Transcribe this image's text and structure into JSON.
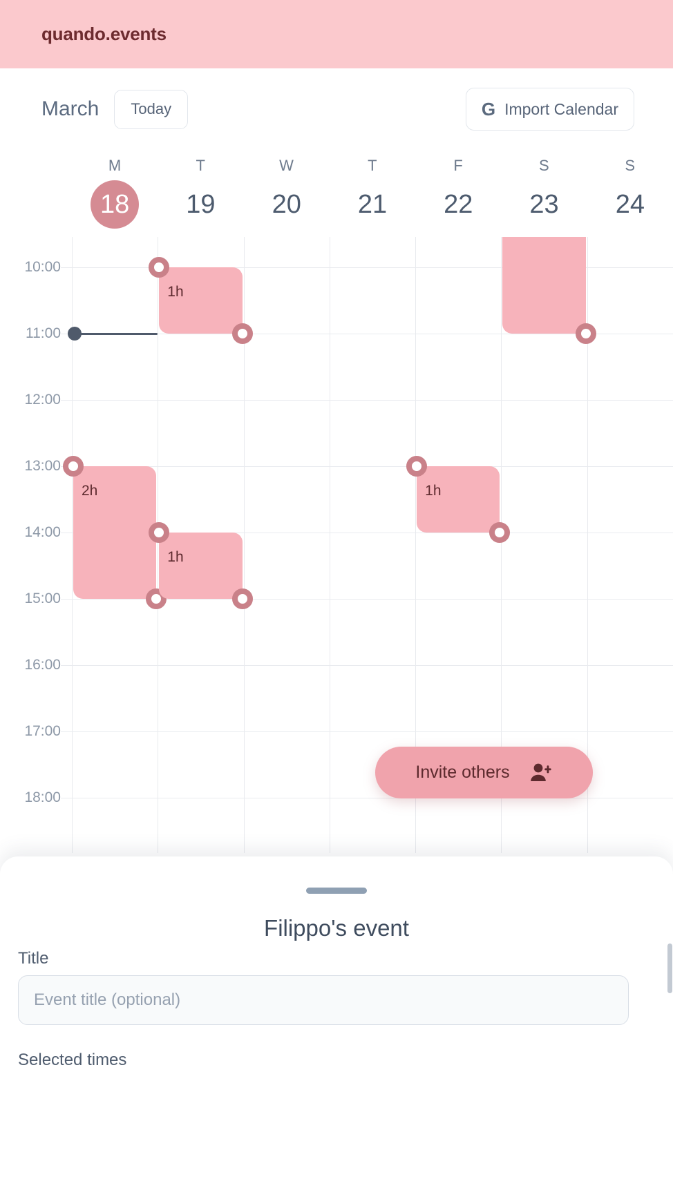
{
  "brand": {
    "name": "quando.events"
  },
  "toolbar": {
    "month": "March",
    "today_label": "Today",
    "import_label": "Import Calendar",
    "google_glyph": "G"
  },
  "week": {
    "days": [
      {
        "dow": "M",
        "num": "18",
        "selected": true
      },
      {
        "dow": "T",
        "num": "19",
        "selected": false
      },
      {
        "dow": "W",
        "num": "20",
        "selected": false
      },
      {
        "dow": "T",
        "num": "21",
        "selected": false
      },
      {
        "dow": "F",
        "num": "22",
        "selected": false
      },
      {
        "dow": "S",
        "num": "23",
        "selected": false
      },
      {
        "dow": "S",
        "num": "24",
        "selected": false
      }
    ]
  },
  "calendar": {
    "hours": [
      "10:00",
      "11:00",
      "12:00",
      "13:00",
      "14:00",
      "15:00",
      "16:00",
      "17:00",
      "18:00"
    ],
    "now_time": "11:00",
    "now_day_index": 0,
    "events": [
      {
        "day_index": 1,
        "start": "10:00",
        "end": "11:00",
        "duration_label": "1h"
      },
      {
        "day_index": 5,
        "start": "09:00",
        "end": "11:00",
        "duration_label": "",
        "clipped_top": true
      },
      {
        "day_index": 0,
        "start": "13:00",
        "end": "15:00",
        "duration_label": "2h"
      },
      {
        "day_index": 1,
        "start": "14:00",
        "end": "15:00",
        "duration_label": "1h"
      },
      {
        "day_index": 4,
        "start": "13:00",
        "end": "14:00",
        "duration_label": "1h"
      }
    ]
  },
  "invite": {
    "label": "Invite others",
    "icon": "person-add-icon"
  },
  "sheet": {
    "title": "Filippo's event",
    "title_field_label": "Title",
    "title_placeholder": "Event title (optional)",
    "title_value": "",
    "selected_times_label": "Selected times"
  },
  "colors": {
    "brand_bar": "#fbc9cd",
    "brand_text": "#6d2b2f",
    "event_fill": "#f7b3bb",
    "handle_ring": "#c98189",
    "selected_day": "#d58b93",
    "accent_fab": "#f0a3ac",
    "text_muted": "#8d98a7",
    "text_primary": "#4d5b6e"
  }
}
